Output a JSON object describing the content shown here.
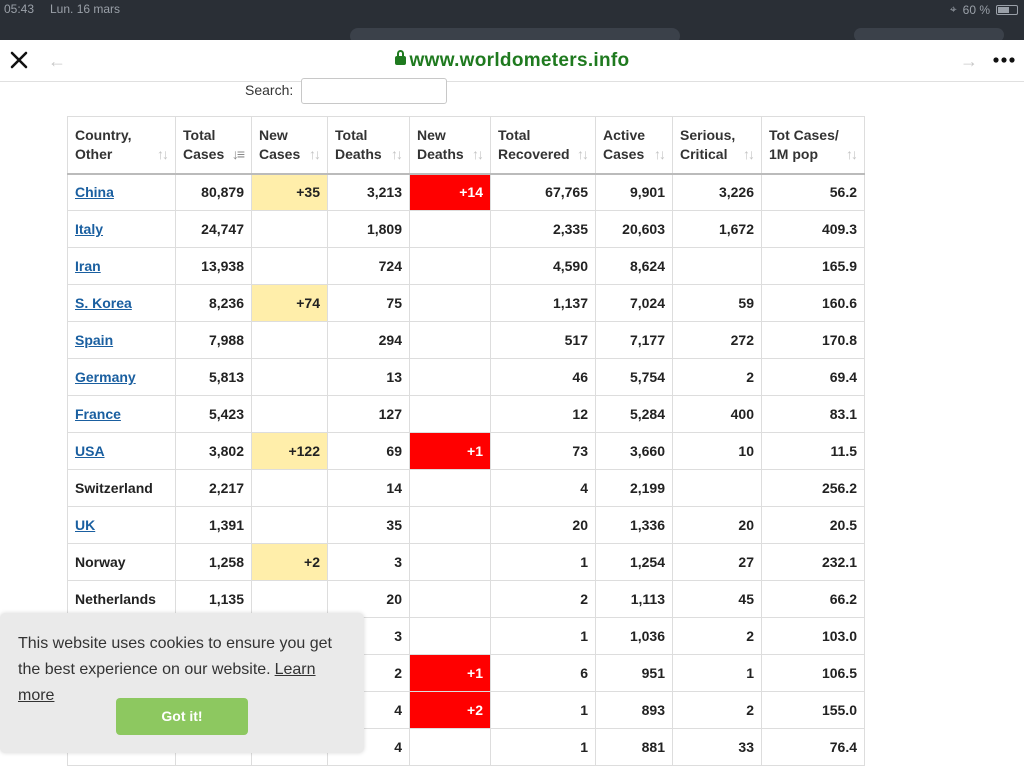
{
  "status_bar": {
    "time": "05:43",
    "date": "Lun. 16 mars",
    "battery": "60 %"
  },
  "browser": {
    "url": "www.worldometers.info",
    "close_icon": "close-icon",
    "back_icon": "arrow-left-icon",
    "forward_icon": "arrow-right-icon",
    "more_icon": "more-icon"
  },
  "search": {
    "label": "Search:",
    "value": "",
    "placeholder": ""
  },
  "table": {
    "headers": [
      [
        "Country,",
        "Other"
      ],
      [
        "Total",
        "Cases"
      ],
      [
        "New",
        "Cases"
      ],
      [
        "Total",
        "Deaths"
      ],
      [
        "New",
        "Deaths"
      ],
      [
        "Total",
        "Recovered"
      ],
      [
        "Active",
        "Cases"
      ],
      [
        "Serious,",
        "Critical"
      ],
      [
        "Tot Cases/",
        "1M pop"
      ]
    ],
    "rows": [
      {
        "country": "China",
        "link": true,
        "total_cases": "80,879",
        "new_cases": "+35",
        "total_deaths": "3,213",
        "new_deaths": "+14",
        "total_recovered": "67,765",
        "active_cases": "9,901",
        "serious_critical": "3,226",
        "per_million": "56.2"
      },
      {
        "country": "Italy",
        "link": true,
        "total_cases": "24,747",
        "new_cases": "",
        "total_deaths": "1,809",
        "new_deaths": "",
        "total_recovered": "2,335",
        "active_cases": "20,603",
        "serious_critical": "1,672",
        "per_million": "409.3"
      },
      {
        "country": "Iran",
        "link": true,
        "total_cases": "13,938",
        "new_cases": "",
        "total_deaths": "724",
        "new_deaths": "",
        "total_recovered": "4,590",
        "active_cases": "8,624",
        "serious_critical": "",
        "per_million": "165.9"
      },
      {
        "country": "S. Korea",
        "link": true,
        "total_cases": "8,236",
        "new_cases": "+74",
        "total_deaths": "75",
        "new_deaths": "",
        "total_recovered": "1,137",
        "active_cases": "7,024",
        "serious_critical": "59",
        "per_million": "160.6"
      },
      {
        "country": "Spain",
        "link": true,
        "total_cases": "7,988",
        "new_cases": "",
        "total_deaths": "294",
        "new_deaths": "",
        "total_recovered": "517",
        "active_cases": "7,177",
        "serious_critical": "272",
        "per_million": "170.8"
      },
      {
        "country": "Germany",
        "link": true,
        "total_cases": "5,813",
        "new_cases": "",
        "total_deaths": "13",
        "new_deaths": "",
        "total_recovered": "46",
        "active_cases": "5,754",
        "serious_critical": "2",
        "per_million": "69.4"
      },
      {
        "country": "France",
        "link": true,
        "total_cases": "5,423",
        "new_cases": "",
        "total_deaths": "127",
        "new_deaths": "",
        "total_recovered": "12",
        "active_cases": "5,284",
        "serious_critical": "400",
        "per_million": "83.1"
      },
      {
        "country": "USA",
        "link": true,
        "total_cases": "3,802",
        "new_cases": "+122",
        "total_deaths": "69",
        "new_deaths": "+1",
        "total_recovered": "73",
        "active_cases": "3,660",
        "serious_critical": "10",
        "per_million": "11.5"
      },
      {
        "country": "Switzerland",
        "link": false,
        "total_cases": "2,217",
        "new_cases": "",
        "total_deaths": "14",
        "new_deaths": "",
        "total_recovered": "4",
        "active_cases": "2,199",
        "serious_critical": "",
        "per_million": "256.2"
      },
      {
        "country": "UK",
        "link": true,
        "total_cases": "1,391",
        "new_cases": "",
        "total_deaths": "35",
        "new_deaths": "",
        "total_recovered": "20",
        "active_cases": "1,336",
        "serious_critical": "20",
        "per_million": "20.5"
      },
      {
        "country": "Norway",
        "link": false,
        "total_cases": "1,258",
        "new_cases": "+2",
        "total_deaths": "3",
        "new_deaths": "",
        "total_recovered": "1",
        "active_cases": "1,254",
        "serious_critical": "27",
        "per_million": "232.1"
      },
      {
        "country": "Netherlands",
        "link": false,
        "total_cases": "1,135",
        "new_cases": "",
        "total_deaths": "20",
        "new_deaths": "",
        "total_recovered": "2",
        "active_cases": "1,113",
        "serious_critical": "45",
        "per_million": "66.2"
      },
      {
        "country": "",
        "link": false,
        "total_cases": "",
        "new_cases": "",
        "total_deaths": "3",
        "new_deaths": "",
        "total_recovered": "1",
        "active_cases": "1,036",
        "serious_critical": "2",
        "per_million": "103.0"
      },
      {
        "country": "",
        "link": false,
        "total_cases": "",
        "new_cases": "",
        "total_deaths": "2",
        "new_deaths": "+1",
        "total_recovered": "6",
        "active_cases": "951",
        "serious_critical": "1",
        "per_million": "106.5"
      },
      {
        "country": "",
        "link": false,
        "total_cases": "",
        "new_cases": "",
        "total_deaths": "4",
        "new_deaths": "+2",
        "total_recovered": "1",
        "active_cases": "893",
        "serious_critical": "2",
        "per_million": "155.0"
      },
      {
        "country": "",
        "link": false,
        "total_cases": "",
        "new_cases": "",
        "total_deaths": "4",
        "new_deaths": "",
        "total_recovered": "1",
        "active_cases": "881",
        "serious_critical": "33",
        "per_million": "76.4"
      }
    ]
  },
  "cookie": {
    "text": "This website uses cookies to ensure you get the best experience on our website.",
    "link": "Learn more",
    "button": "Got it!"
  },
  "colors": {
    "new_cases_highlight": "#ffeeaa",
    "new_deaths_highlight": "#ff0000",
    "link": "#1a5fa0",
    "url_green": "#1f7a1f",
    "cookie_button": "#8dc860"
  }
}
